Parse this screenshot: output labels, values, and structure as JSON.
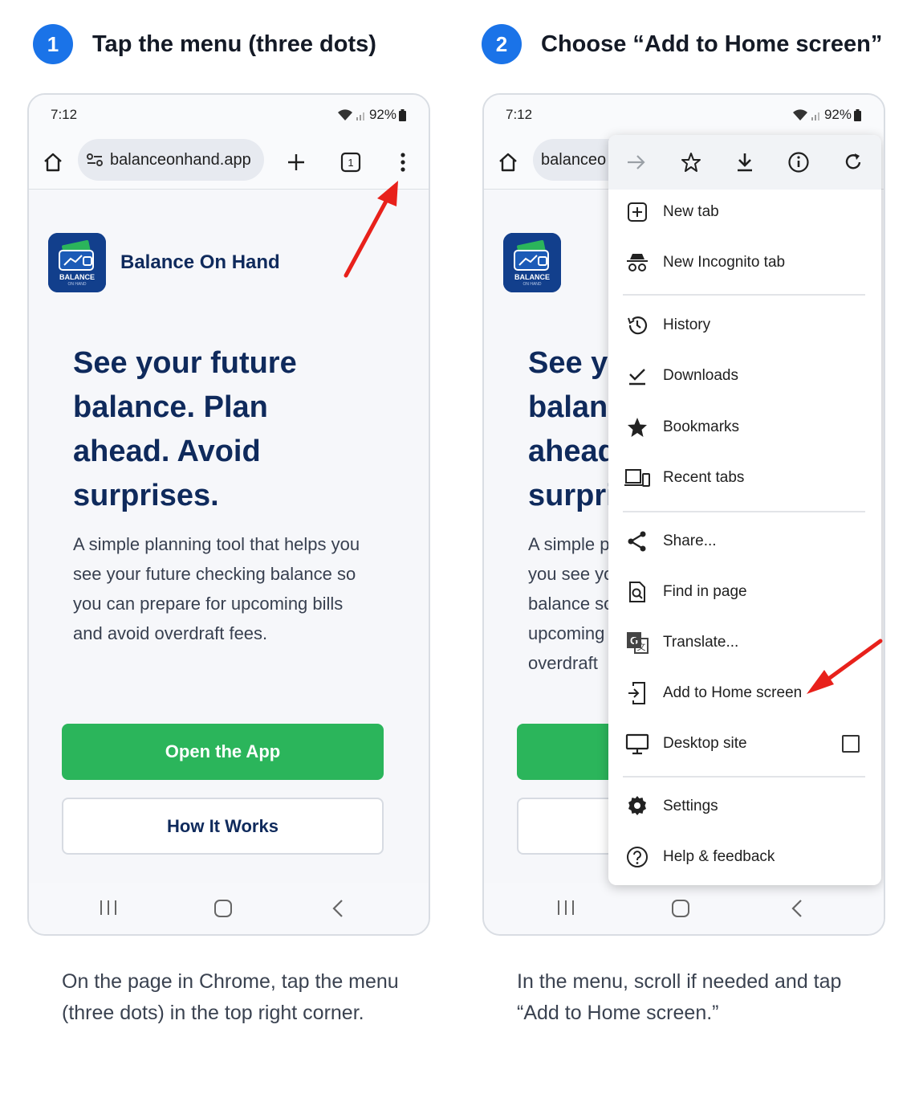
{
  "colors": {
    "accent": "#1a73e8",
    "brand_navy": "#0f2a5c",
    "button_green": "#2bb55b",
    "arrow_red": "#e8211b"
  },
  "steps": [
    {
      "number": "1",
      "title": "Tap the menu (three dots)",
      "caption": "On the page in Chrome, tap the menu (three dots) in the top right corner."
    },
    {
      "number": "2",
      "title": "Choose “Add to Home screen”",
      "caption": "In the menu, scroll if needed and tap “Add to Home screen.”"
    }
  ],
  "phone": {
    "time": "7:12",
    "battery": "92%",
    "url": "balanceonhand.app",
    "url_truncated": "balanceo",
    "tab_count": "1",
    "icons": [
      "home-icon",
      "site-settings-icon",
      "new-tab-plus-icon",
      "tab-switcher-icon",
      "more-vert-icon"
    ]
  },
  "page": {
    "logo_text": "BALANCE",
    "logo_subtext": "ON HAND",
    "brand": "Balance On Hand",
    "headline": "See your future balance. Plan ahead. Avoid surprises.",
    "headline_truncated_lines": [
      "See y",
      "balan",
      "ahead",
      "surpri"
    ],
    "body": "A simple planning tool that helps you see your future checking balance so you can prepare for upcoming bills and avoid overdraft fees.",
    "body_truncated_lines": [
      "A simple p",
      "you see yo",
      "balance so",
      "upcoming",
      "overdraft"
    ],
    "primary_button": "Open the App",
    "secondary_button": "How It Works"
  },
  "menu": {
    "top_icons": [
      "forward-arrow-icon",
      "bookmark-star-icon",
      "download-icon",
      "info-icon",
      "refresh-icon"
    ],
    "items": [
      {
        "label": "New tab",
        "icon": "new-tab-icon"
      },
      {
        "label": "New Incognito tab",
        "icon": "incognito-icon"
      },
      {
        "label": "History",
        "icon": "history-icon"
      },
      {
        "label": "Downloads",
        "icon": "downloads-check-icon"
      },
      {
        "label": "Bookmarks",
        "icon": "bookmarks-star-icon"
      },
      {
        "label": "Recent tabs",
        "icon": "recent-tabs-icon"
      },
      {
        "label": "Share...",
        "icon": "share-icon"
      },
      {
        "label": "Find in page",
        "icon": "find-in-page-icon"
      },
      {
        "label": "Translate...",
        "icon": "translate-icon"
      },
      {
        "label": "Add to Home screen",
        "icon": "add-to-home-icon"
      },
      {
        "label": "Desktop site",
        "icon": "desktop-icon"
      },
      {
        "label": "Settings",
        "icon": "settings-gear-icon"
      },
      {
        "label": "Help & feedback",
        "icon": "help-icon"
      }
    ],
    "desktop_site_checked": false
  }
}
